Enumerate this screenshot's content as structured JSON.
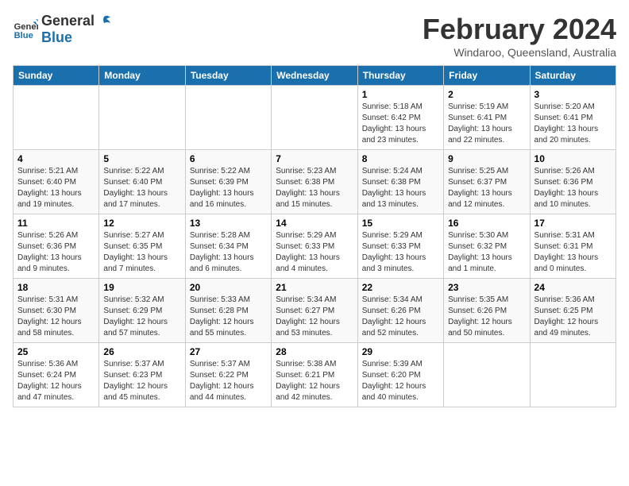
{
  "header": {
    "logo_line1": "General",
    "logo_line2": "Blue",
    "month": "February 2024",
    "location": "Windaroo, Queensland, Australia"
  },
  "columns": [
    "Sunday",
    "Monday",
    "Tuesday",
    "Wednesday",
    "Thursday",
    "Friday",
    "Saturday"
  ],
  "weeks": [
    [
      {
        "day": "",
        "info": ""
      },
      {
        "day": "",
        "info": ""
      },
      {
        "day": "",
        "info": ""
      },
      {
        "day": "",
        "info": ""
      },
      {
        "day": "1",
        "info": "Sunrise: 5:18 AM\nSunset: 6:42 PM\nDaylight: 13 hours\nand 23 minutes."
      },
      {
        "day": "2",
        "info": "Sunrise: 5:19 AM\nSunset: 6:41 PM\nDaylight: 13 hours\nand 22 minutes."
      },
      {
        "day": "3",
        "info": "Sunrise: 5:20 AM\nSunset: 6:41 PM\nDaylight: 13 hours\nand 20 minutes."
      }
    ],
    [
      {
        "day": "4",
        "info": "Sunrise: 5:21 AM\nSunset: 6:40 PM\nDaylight: 13 hours\nand 19 minutes."
      },
      {
        "day": "5",
        "info": "Sunrise: 5:22 AM\nSunset: 6:40 PM\nDaylight: 13 hours\nand 17 minutes."
      },
      {
        "day": "6",
        "info": "Sunrise: 5:22 AM\nSunset: 6:39 PM\nDaylight: 13 hours\nand 16 minutes."
      },
      {
        "day": "7",
        "info": "Sunrise: 5:23 AM\nSunset: 6:38 PM\nDaylight: 13 hours\nand 15 minutes."
      },
      {
        "day": "8",
        "info": "Sunrise: 5:24 AM\nSunset: 6:38 PM\nDaylight: 13 hours\nand 13 minutes."
      },
      {
        "day": "9",
        "info": "Sunrise: 5:25 AM\nSunset: 6:37 PM\nDaylight: 13 hours\nand 12 minutes."
      },
      {
        "day": "10",
        "info": "Sunrise: 5:26 AM\nSunset: 6:36 PM\nDaylight: 13 hours\nand 10 minutes."
      }
    ],
    [
      {
        "day": "11",
        "info": "Sunrise: 5:26 AM\nSunset: 6:36 PM\nDaylight: 13 hours\nand 9 minutes."
      },
      {
        "day": "12",
        "info": "Sunrise: 5:27 AM\nSunset: 6:35 PM\nDaylight: 13 hours\nand 7 minutes."
      },
      {
        "day": "13",
        "info": "Sunrise: 5:28 AM\nSunset: 6:34 PM\nDaylight: 13 hours\nand 6 minutes."
      },
      {
        "day": "14",
        "info": "Sunrise: 5:29 AM\nSunset: 6:33 PM\nDaylight: 13 hours\nand 4 minutes."
      },
      {
        "day": "15",
        "info": "Sunrise: 5:29 AM\nSunset: 6:33 PM\nDaylight: 13 hours\nand 3 minutes."
      },
      {
        "day": "16",
        "info": "Sunrise: 5:30 AM\nSunset: 6:32 PM\nDaylight: 13 hours\nand 1 minute."
      },
      {
        "day": "17",
        "info": "Sunrise: 5:31 AM\nSunset: 6:31 PM\nDaylight: 13 hours\nand 0 minutes."
      }
    ],
    [
      {
        "day": "18",
        "info": "Sunrise: 5:31 AM\nSunset: 6:30 PM\nDaylight: 12 hours\nand 58 minutes."
      },
      {
        "day": "19",
        "info": "Sunrise: 5:32 AM\nSunset: 6:29 PM\nDaylight: 12 hours\nand 57 minutes."
      },
      {
        "day": "20",
        "info": "Sunrise: 5:33 AM\nSunset: 6:28 PM\nDaylight: 12 hours\nand 55 minutes."
      },
      {
        "day": "21",
        "info": "Sunrise: 5:34 AM\nSunset: 6:27 PM\nDaylight: 12 hours\nand 53 minutes."
      },
      {
        "day": "22",
        "info": "Sunrise: 5:34 AM\nSunset: 6:26 PM\nDaylight: 12 hours\nand 52 minutes."
      },
      {
        "day": "23",
        "info": "Sunrise: 5:35 AM\nSunset: 6:26 PM\nDaylight: 12 hours\nand 50 minutes."
      },
      {
        "day": "24",
        "info": "Sunrise: 5:36 AM\nSunset: 6:25 PM\nDaylight: 12 hours\nand 49 minutes."
      }
    ],
    [
      {
        "day": "25",
        "info": "Sunrise: 5:36 AM\nSunset: 6:24 PM\nDaylight: 12 hours\nand 47 minutes."
      },
      {
        "day": "26",
        "info": "Sunrise: 5:37 AM\nSunset: 6:23 PM\nDaylight: 12 hours\nand 45 minutes."
      },
      {
        "day": "27",
        "info": "Sunrise: 5:37 AM\nSunset: 6:22 PM\nDaylight: 12 hours\nand 44 minutes."
      },
      {
        "day": "28",
        "info": "Sunrise: 5:38 AM\nSunset: 6:21 PM\nDaylight: 12 hours\nand 42 minutes."
      },
      {
        "day": "29",
        "info": "Sunrise: 5:39 AM\nSunset: 6:20 PM\nDaylight: 12 hours\nand 40 minutes."
      },
      {
        "day": "",
        "info": ""
      },
      {
        "day": "",
        "info": ""
      }
    ]
  ]
}
